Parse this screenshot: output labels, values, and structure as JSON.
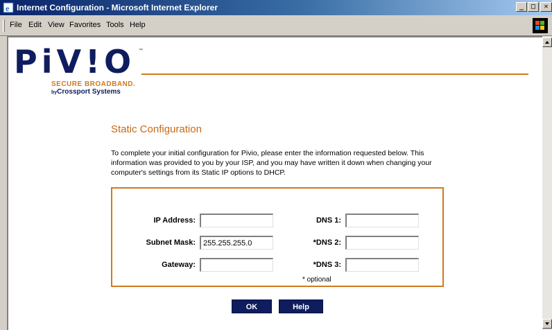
{
  "window": {
    "title": "Internet Configuration - Microsoft Internet Explorer",
    "minimize": "_",
    "maximize": "□",
    "close": "✕"
  },
  "menu": [
    "File",
    "Edit",
    "View",
    "Favorites",
    "Tools",
    "Help"
  ],
  "logo": {
    "word": "PiV!O",
    "tm": "™",
    "tagline": "SECURE BROADBAND.",
    "by": "by",
    "company": "Crossport Systems"
  },
  "page": {
    "title": "Static Configuration",
    "intro": "To complete your initial configuration for Pivio, please enter the information requested below. This information was provided to you by your ISP, and you may have written it down when changing your computer's settings from its Static IP options to DHCP."
  },
  "form": {
    "ip_label": "IP Address:",
    "ip_value": "",
    "subnet_label": "Subnet Mask:",
    "subnet_value": "255.255.255.0",
    "gateway_label": "Gateway:",
    "gateway_value": "",
    "dns1_label": "DNS 1:",
    "dns1_value": "",
    "dns2_label": "*DNS 2:",
    "dns2_value": "",
    "dns3_label": "*DNS 3:",
    "dns3_value": "",
    "optional_note": "* optional"
  },
  "buttons": {
    "ok": "OK",
    "help": "Help"
  },
  "colors": {
    "accent_orange": "#d07a1c",
    "title_orange": "#c96a12",
    "navy": "#0f1d5e",
    "titlebar": "#0a246a"
  }
}
